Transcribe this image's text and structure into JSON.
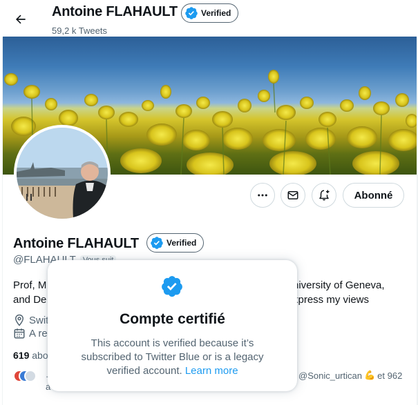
{
  "header": {
    "back_icon": "arrow-left-icon",
    "name": "Antoine FLAHAULT",
    "verified_label": "Verified",
    "tweet_count": "59,2 k Tweets"
  },
  "profile": {
    "name": "Antoine FLAHAULT",
    "verified_label": "Verified",
    "handle": "@FLAHAULT",
    "follows_you": "Vous suit",
    "bio_line1_start": "Prof, M",
    "bio_line1_end": "niversity of Geneva,",
    "bio_line2_start": "and De",
    "bio_line2_end": "xpress my views",
    "location_start": "Swit",
    "joined_start": "A re",
    "following_value": "619",
    "following_label": "abo",
    "known_followers_end": "@Sonic_urtican",
    "known_followers_emoji": "💪",
    "known_followers_suffix": "et 962",
    "known_followers_line2": "a",
    "known_followers_dots": "·"
  },
  "actions": {
    "more_icon": "more-horizontal-icon",
    "message_icon": "envelope-icon",
    "notify_icon": "bell-plus-icon",
    "following_label": "Abonné"
  },
  "popup": {
    "icon": "verified-badge-icon",
    "title": "Compte certifié",
    "body": "This account is verified because it’s subscribed to Twitter Blue or is a legacy verified account.",
    "link": "Learn more"
  },
  "colors": {
    "accent": "#1d9bf0",
    "text": "#0f1419",
    "muted": "#536471",
    "border": "#cfd9de"
  }
}
